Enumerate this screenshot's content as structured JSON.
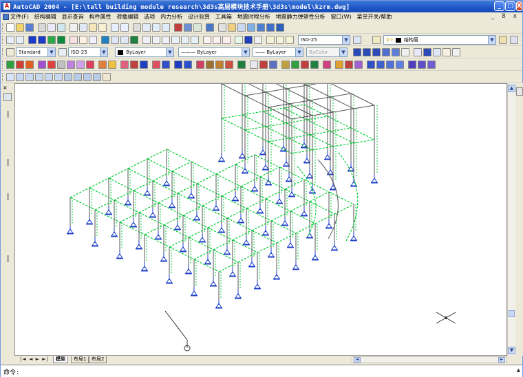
{
  "window": {
    "title": "AutoCAD 2004 - [E:\\tall building module research\\3d3s高层模块技术手册\\3d3s\\model\\kzrm.dwg]",
    "controls": [
      "_",
      "□",
      "X"
    ]
  },
  "menu": {
    "items": [
      "文件(F)",
      "结构编辑",
      "显示查询",
      "构件属性",
      "荷载编辑",
      "选项",
      "内力分析",
      "设计验算",
      "工具箱",
      "地震时程分析",
      "地震静力弹塑性分析",
      "窗口(W)",
      "菜单开关/帮助"
    ],
    "doc_controls": "_ 8 x"
  },
  "toolbar_row3": {
    "dimstyle": "ISO-25",
    "layer_name": "结构层"
  },
  "toolbar_row4": {
    "text_style": "Standard",
    "dim_style": "ISO-25",
    "color": "ByLayer",
    "linetype": "ByLayer",
    "lineweight": "ByLayer",
    "plotstyle": "ByColor"
  },
  "tabs": {
    "nav": "|◄ ◄ ► ►|",
    "items": [
      "模型",
      "布局1",
      "布局2"
    ],
    "active": "模型"
  },
  "command_line": {
    "prompt": "命令:"
  },
  "icon_colors": {
    "ui_accent": "#1f55c6",
    "model_member": "#00cc33",
    "model_support": "#1a3cc8",
    "model_frame": "#555555"
  }
}
